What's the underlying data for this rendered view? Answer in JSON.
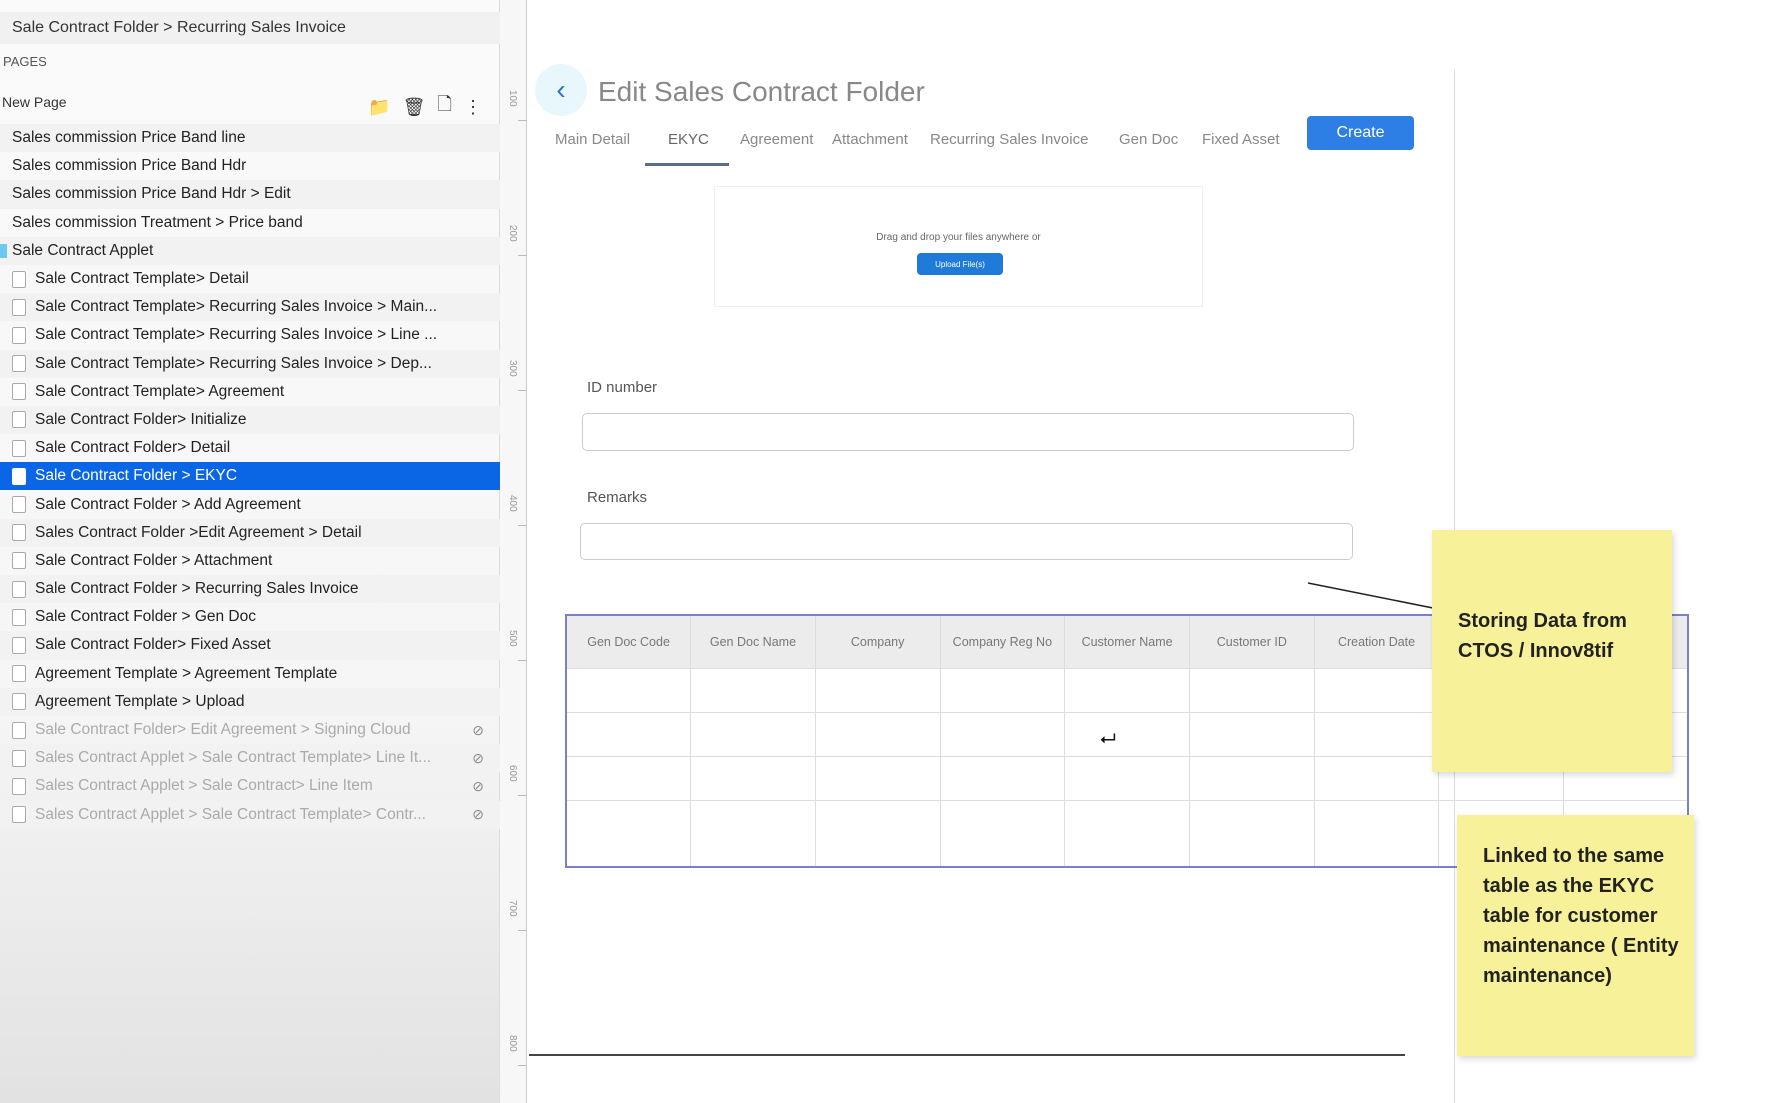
{
  "sidebar": {
    "breadcrumb": "Sale Contract Folder > Recurring Sales Invoice",
    "pages_label": "PAGES",
    "new_page": "New Page",
    "toolbar_icons": [
      "add-folder-icon",
      "trash-icon",
      "copy-icon",
      "more-icon"
    ],
    "items": [
      {
        "label": "Sales commission Price Band line",
        "level": 0
      },
      {
        "label": "Sales commission Price Band Hdr",
        "level": 0
      },
      {
        "label": "Sales commission Price Band Hdr > Edit",
        "level": 0
      },
      {
        "label": "Sales commission Treatment > Price band",
        "level": 0
      },
      {
        "label": "Sale Contract Applet",
        "level": 0,
        "folder": true
      },
      {
        "label": "Sale Contract Template> Detail",
        "level": 1
      },
      {
        "label": "Sale Contract Template> Recurring Sales Invoice > Main...",
        "level": 1
      },
      {
        "label": "Sale Contract Template> Recurring Sales Invoice > Line ...",
        "level": 1
      },
      {
        "label": "Sale Contract Template> Recurring Sales Invoice > Dep...",
        "level": 1
      },
      {
        "label": "Sale Contract Template> Agreement",
        "level": 1
      },
      {
        "label": "Sale Contract Folder> Initialize",
        "level": 1
      },
      {
        "label": "Sale Contract Folder> Detail",
        "level": 1
      },
      {
        "label": "Sale Contract Folder > EKYC",
        "level": 1,
        "selected": true
      },
      {
        "label": "Sale Contract Folder > Add Agreement",
        "level": 1
      },
      {
        "label": "Sales Contract Folder >Edit Agreement > Detail",
        "level": 1
      },
      {
        "label": "Sale Contract Folder > Attachment",
        "level": 1
      },
      {
        "label": "Sale Contract Folder > Recurring Sales Invoice",
        "level": 1
      },
      {
        "label": "Sale Contract Folder > Gen Doc",
        "level": 1
      },
      {
        "label": "Sale Contract Folder> Fixed Asset",
        "level": 1
      },
      {
        "label": "Agreement Template > Agreement Template",
        "level": 1
      },
      {
        "label": "Agreement Template > Upload",
        "level": 1
      },
      {
        "label": "Sale Contract Folder> Edit Agreement > Signing Cloud",
        "level": 1,
        "hidden": true
      },
      {
        "label": "Sales Contract Applet > Sale Contract Template> Line It...",
        "level": 1,
        "hidden": true
      },
      {
        "label": "Sales Contract Applet > Sale Contract> Line Item",
        "level": 1,
        "hidden": true
      },
      {
        "label": "Sales Contract Applet > Sale Contract Template> Contr...",
        "level": 1,
        "hidden": true
      }
    ]
  },
  "ruler": [
    "100",
    "200",
    "300",
    "400",
    "500",
    "600",
    "700",
    "800"
  ],
  "page": {
    "title": "Edit Sales Contract Folder",
    "tabs": [
      "Main Detail",
      "EKYC",
      "Agreement",
      "Attachment",
      "Recurring Sales Invoice",
      "Gen Doc",
      "Fixed Asset"
    ],
    "active_tab": "EKYC",
    "create_label": "Create",
    "upload": {
      "text": "Drag and drop your files anywhere or",
      "button": "Upload File(s)"
    },
    "id_label": "ID number",
    "id_value": "",
    "remarks_label": "Remarks",
    "remarks_value": "",
    "table": {
      "columns": [
        "Gen Doc Code",
        "Gen Doc Name",
        "Company",
        "Company Reg No",
        "Customer Name",
        "Customer ID",
        "Creation Date",
        "",
        ""
      ],
      "empty_rows": 4
    }
  },
  "notes": {
    "note1": "Storing Data from CTOS / Innov8tif",
    "note2": "Linked to the same table as the EKYC table for customer maintenance ( Entity maintenance)"
  },
  "colors": {
    "accent": "#2d7fe6",
    "selected": "#0a66e4",
    "sticky": "#f7f29a",
    "table_border": "#7b7fc8"
  }
}
